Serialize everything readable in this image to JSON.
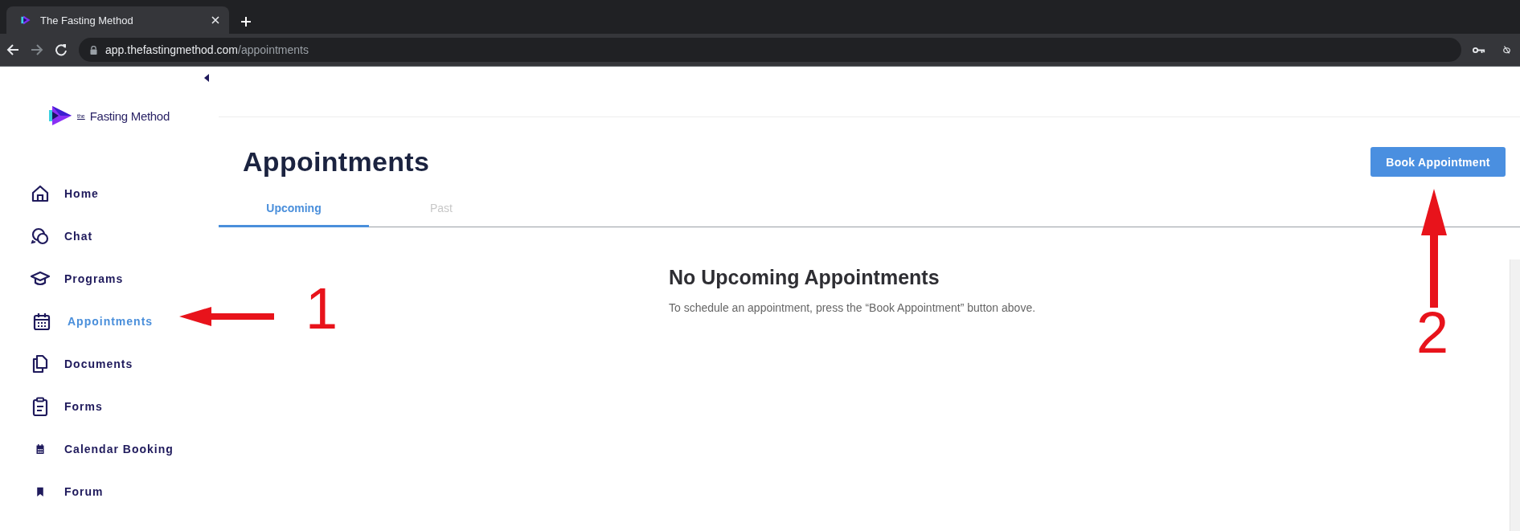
{
  "browser": {
    "tab_title": "The Fasting Method",
    "url_host": "app.thefastingmethod.com",
    "url_path": "/appointments"
  },
  "sidebar": {
    "logo": {
      "small": "the",
      "name": "Fasting Method"
    },
    "items": [
      {
        "label": "Home",
        "selected": false
      },
      {
        "label": "Chat",
        "selected": false
      },
      {
        "label": "Programs",
        "selected": false
      },
      {
        "label": "Appointments",
        "selected": true
      },
      {
        "label": "Documents",
        "selected": false
      },
      {
        "label": "Forms",
        "selected": false
      },
      {
        "label": "Calendar Booking",
        "selected": false
      },
      {
        "label": "Forum",
        "selected": false
      }
    ]
  },
  "page": {
    "title": "Appointments",
    "action": "Book Appointment",
    "tabs": [
      {
        "label": "Upcoming",
        "selected": true
      },
      {
        "label": "Past",
        "selected": false
      }
    ],
    "empty_state": {
      "title": "No Upcoming Appointments",
      "text": "To schedule an appointment, press the “Book Appointment” button above."
    }
  },
  "annotations": [
    {
      "label": "1"
    },
    {
      "label": "2"
    }
  ]
}
